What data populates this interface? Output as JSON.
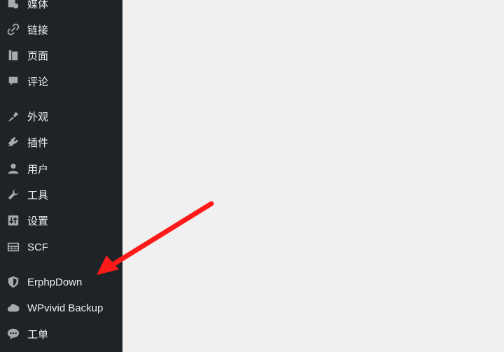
{
  "sidebar": {
    "items": [
      {
        "label": "媒体",
        "icon": "media-icon"
      },
      {
        "label": "链接",
        "icon": "link-icon"
      },
      {
        "label": "页面",
        "icon": "page-icon"
      },
      {
        "label": "评论",
        "icon": "comment-icon"
      },
      {
        "label": "外观",
        "icon": "appearance-icon"
      },
      {
        "label": "插件",
        "icon": "plugin-icon"
      },
      {
        "label": "用户",
        "icon": "user-icon"
      },
      {
        "label": "工具",
        "icon": "wrench-icon"
      },
      {
        "label": "设置",
        "icon": "settings-icon"
      },
      {
        "label": "SCF",
        "icon": "scf-icon"
      },
      {
        "label": "ErphpDown",
        "icon": "shield-icon"
      },
      {
        "label": "WPvivid Backup",
        "icon": "cloud-icon"
      },
      {
        "label": "工单",
        "icon": "chat-bubble-icon"
      }
    ]
  },
  "colors": {
    "sidebar_bg": "#1d2327",
    "sidebar_text": "#f0f0f1",
    "sidebar_icon": "#a7aaad",
    "content_bg": "#f0f0f1",
    "arrow": "#ff1a1a"
  }
}
